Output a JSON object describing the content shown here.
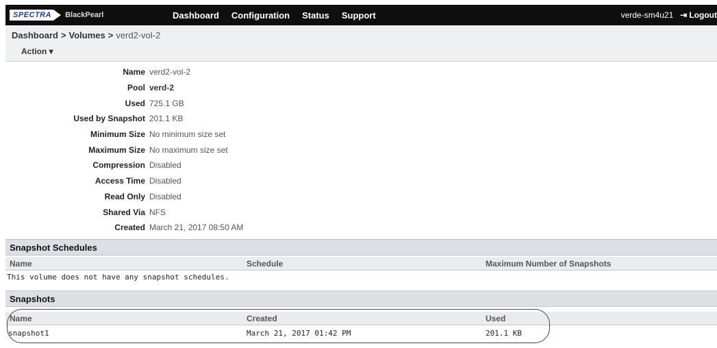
{
  "brand": {
    "spectra": "SPECTRA",
    "product": "BlackPearl"
  },
  "nav": {
    "items": [
      "Dashboard",
      "Configuration",
      "Status",
      "Support"
    ]
  },
  "user": {
    "name": "verde-sm4u21",
    "logout_label": "Logout",
    "logout_icon": "logout-icon"
  },
  "breadcrumb": {
    "items": [
      "Dashboard",
      "Volumes"
    ],
    "current": "verd2-vol-2",
    "separator": ">"
  },
  "action_menu": {
    "label": "Action ▾"
  },
  "properties": [
    {
      "label": "Name",
      "value": "verd2-vol-2"
    },
    {
      "label": "Pool",
      "value": "verd-2"
    },
    {
      "label": "Used",
      "value": "725.1 GB"
    },
    {
      "label": "Used by Snapshot",
      "value": "201.1 KB"
    },
    {
      "label": "Minimum Size",
      "value": "No minimum size set"
    },
    {
      "label": "Maximum Size",
      "value": "No maximum size set"
    },
    {
      "label": "Compression",
      "value": "Disabled"
    },
    {
      "label": "Access Time",
      "value": "Disabled"
    },
    {
      "label": "Read Only",
      "value": "Disabled"
    },
    {
      "label": "Shared Via",
      "value": "NFS"
    },
    {
      "label": "Created",
      "value": "March 21, 2017 08:50 AM"
    }
  ],
  "snapshot_schedules": {
    "title": "Snapshot Schedules",
    "columns": [
      "Name",
      "Schedule",
      "Maximum Number of Snapshots"
    ],
    "empty_message": "This volume does not have any snapshot schedules."
  },
  "snapshots": {
    "title": "Snapshots",
    "columns": [
      "Name",
      "Created",
      "Used"
    ],
    "rows": [
      {
        "name": "snapshot1",
        "created": "March 21, 2017 01:42 PM",
        "used": "201.1 KB"
      }
    ]
  }
}
